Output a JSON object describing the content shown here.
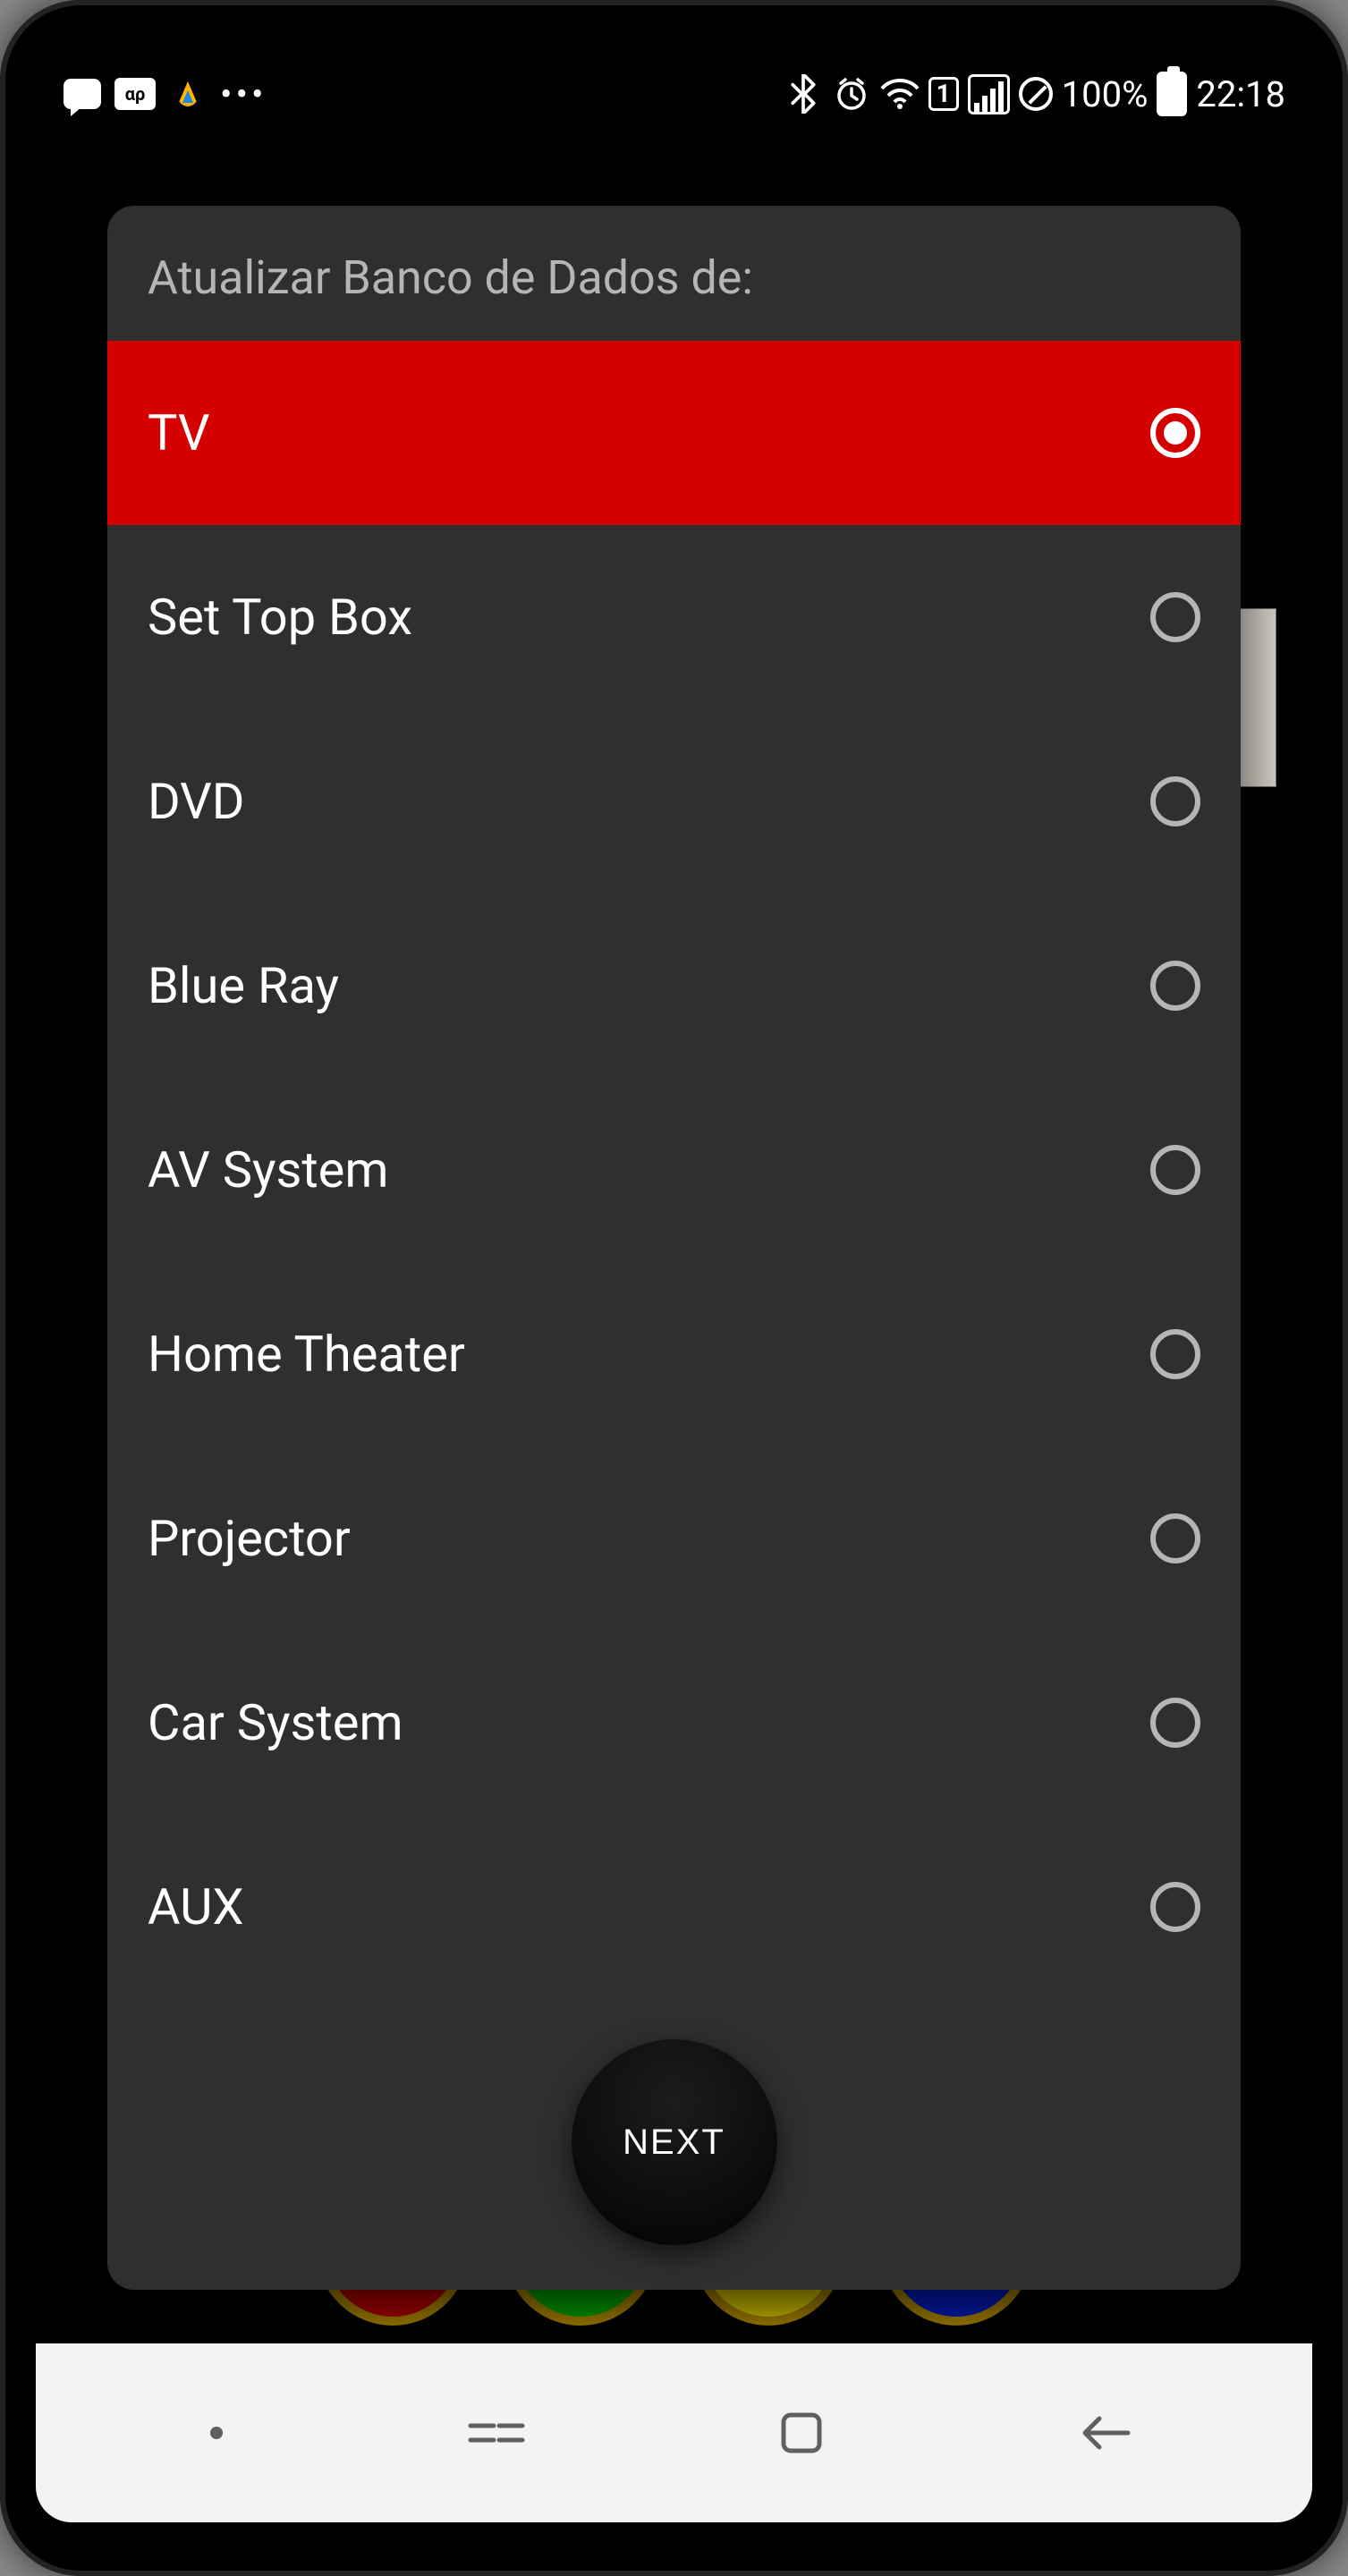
{
  "status": {
    "battery_text": "100%",
    "time": "22:18",
    "sim_label": "1"
  },
  "dialog": {
    "title": "Atualizar Banco de Dados de:",
    "options": [
      {
        "label": "TV",
        "selected": true
      },
      {
        "label": "Set Top Box",
        "selected": false
      },
      {
        "label": "DVD",
        "selected": false
      },
      {
        "label": "Blue Ray",
        "selected": false
      },
      {
        "label": "AV System",
        "selected": false
      },
      {
        "label": "Home Theater",
        "selected": false
      },
      {
        "label": "Projector",
        "selected": false
      },
      {
        "label": "Car System",
        "selected": false
      },
      {
        "label": "AUX",
        "selected": false
      }
    ],
    "next_label": "NEXT"
  }
}
